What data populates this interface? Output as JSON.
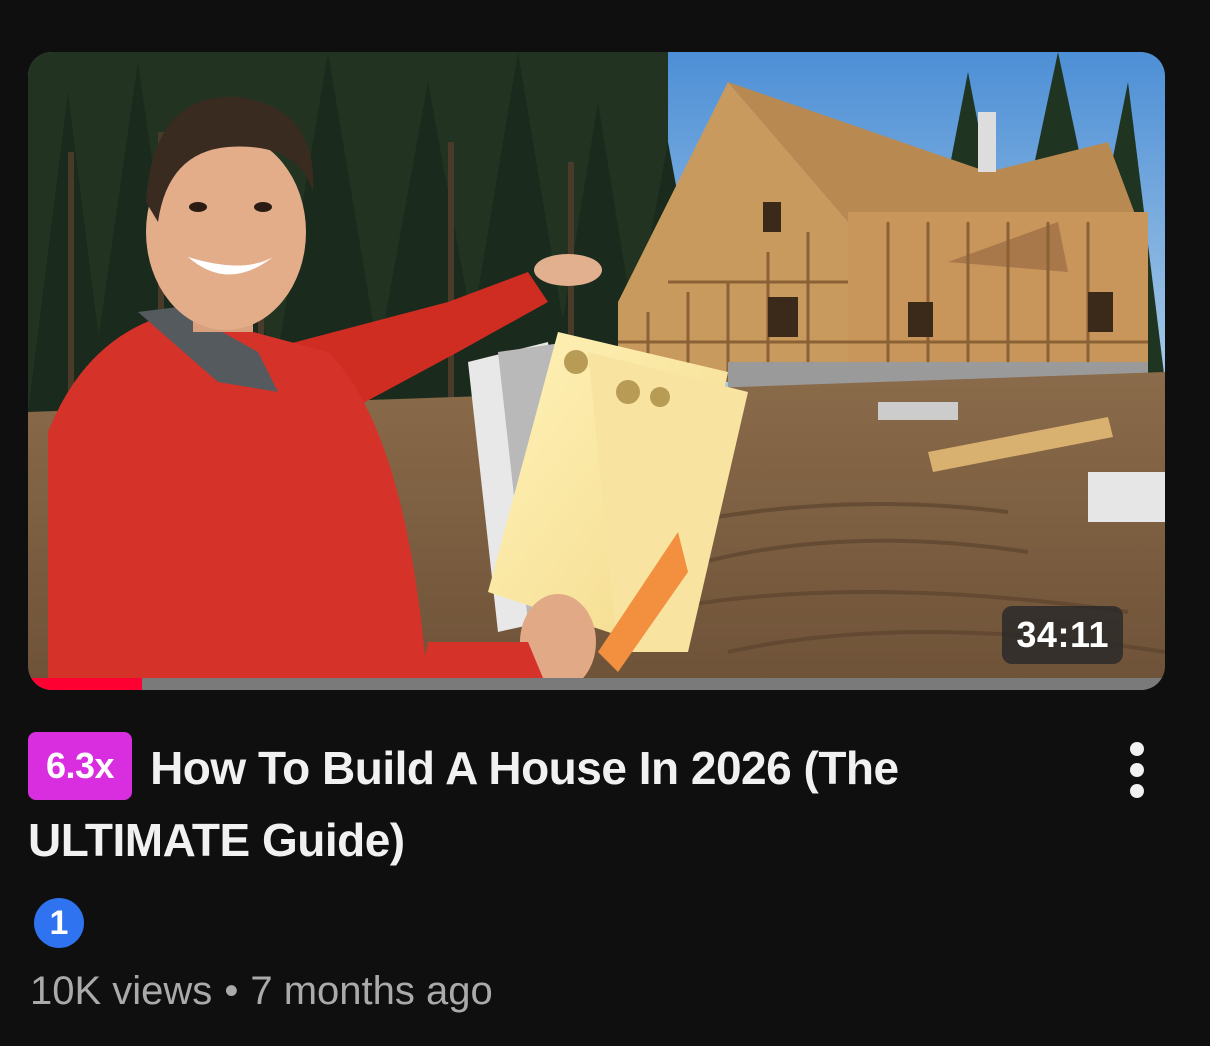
{
  "video": {
    "duration": "34:11",
    "watch_progress_fraction": 0.1,
    "badge": "6.3x",
    "title": "How To Build A House In 2026 (The ULTIMATE Guide)",
    "channel_icon_text": "1",
    "views": "10K views",
    "separator": "•",
    "age": "7 months ago"
  },
  "icons": {
    "more": "more-vert-icon",
    "channel": "channel-avatar-icon"
  },
  "colors": {
    "background": "#0f0f0f",
    "badge": "#d92ee0",
    "progress": "#ff0033",
    "channel_icon": "#2f73f0",
    "meta_text": "#aaaaaa"
  }
}
